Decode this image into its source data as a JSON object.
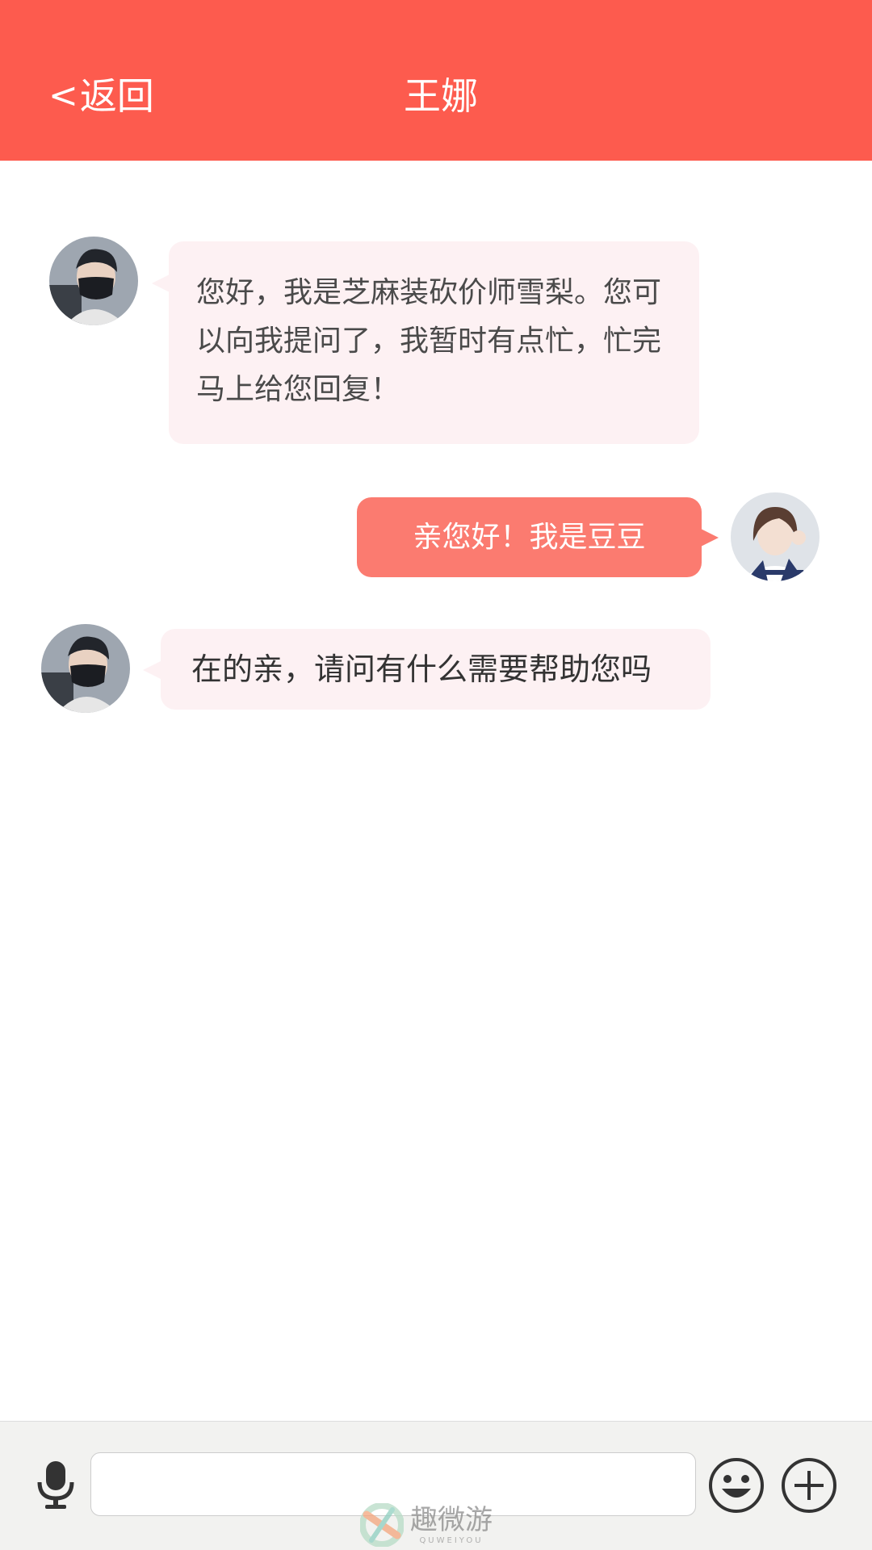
{
  "header": {
    "back_chevron": "<",
    "back_label": "返回",
    "title": "王娜",
    "background": "#fd5b4e"
  },
  "messages": [
    {
      "sender": "agent",
      "avatar": "masked-boy-avatar",
      "text": "您好，我是芝麻装砍价师雪梨。您可以向我提问了，我暂时有点忙，忙完马上给您回复！"
    },
    {
      "sender": "me",
      "avatar": "girl-avatar",
      "text": "亲您好！我是豆豆"
    },
    {
      "sender": "agent",
      "avatar": "masked-boy-avatar",
      "text": "在的亲，请问有什么需要帮助您吗"
    }
  ],
  "colors": {
    "incoming_bubble": "#fdf1f3",
    "outgoing_bubble": "#fb7b70"
  },
  "input_bar": {
    "value": "",
    "placeholder": "",
    "icons": [
      "microphone-icon",
      "emoji-icon",
      "plus-icon"
    ]
  },
  "watermark": {
    "text": "趣微游",
    "subtext": "QUWEIYOU"
  }
}
